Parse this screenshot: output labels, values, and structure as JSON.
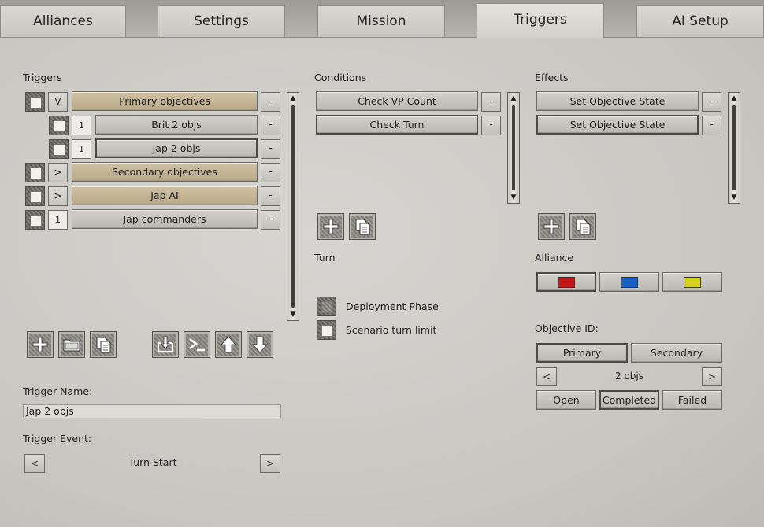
{
  "tabs": [
    "Alliances",
    "Settings",
    "Mission",
    "Triggers",
    "AI Setup"
  ],
  "triggers": {
    "label": "Triggers",
    "rows": [
      {
        "toggle": "V",
        "name": "Primary objectives"
      },
      {
        "toggle": "1",
        "name": "Brit 2 objs"
      },
      {
        "toggle": "1",
        "name": "Jap 2 objs"
      },
      {
        "toggle": ">",
        "name": "Secondary objectives"
      },
      {
        "toggle": ">",
        "name": "Jap AI"
      },
      {
        "toggle": "1",
        "name": "Jap commanders"
      }
    ],
    "remove_label": "-"
  },
  "conditions": {
    "label": "Conditions",
    "items": [
      "Check VP Count",
      "Check Turn"
    ]
  },
  "effects": {
    "label": "Effects",
    "items": [
      "Set Objective State",
      "Set Objective State"
    ]
  },
  "turn": {
    "label": "Turn",
    "options": [
      "Deployment Phase",
      "Scenario turn limit"
    ]
  },
  "alliance": {
    "label": "Alliance",
    "colors": [
      "#c0181a",
      "#1a5fc4",
      "#d6cf1c"
    ]
  },
  "objective": {
    "label": "Objective ID:",
    "types": [
      "Primary",
      "Secondary"
    ],
    "value": "2 objs",
    "prev": "<",
    "next": ">",
    "states": [
      "Open",
      "Completed",
      "Failed"
    ]
  },
  "trigger_name": {
    "label": "Trigger Name:",
    "value": "Jap 2 objs"
  },
  "trigger_event": {
    "label": "Trigger Event:",
    "value": "Turn Start",
    "prev": "<",
    "next": ">"
  },
  "icons": [
    "plus-icon",
    "folder-icon",
    "copy-icon",
    "import-icon",
    "console-icon",
    "arrow-up-icon",
    "arrow-down-icon"
  ]
}
